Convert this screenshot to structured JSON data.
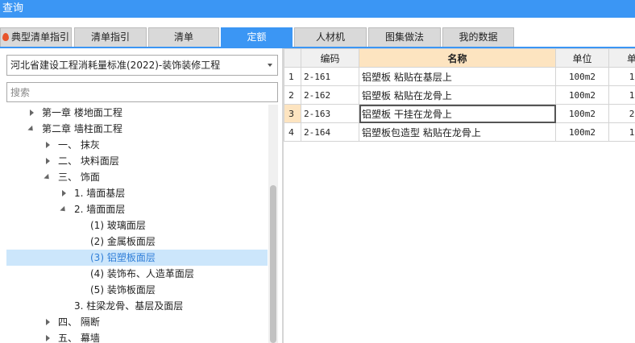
{
  "window": {
    "title": "查询"
  },
  "tabs": [
    {
      "label": "典型清单指引",
      "active": false,
      "has_icon": true
    },
    {
      "label": "清单指引",
      "active": false
    },
    {
      "label": "清单",
      "active": false
    },
    {
      "label": "定额",
      "active": true
    },
    {
      "label": "人材机",
      "active": false
    },
    {
      "label": "图集做法",
      "active": false
    },
    {
      "label": "我的数据",
      "active": false
    }
  ],
  "left_panel": {
    "standard_select": "河北省建设工程消耗量标准(2022)-装饰装修工程",
    "search_placeholder": "搜索",
    "tree": [
      {
        "label": "第一章  楼地面工程",
        "toggle": "collapsed",
        "selected": false
      },
      {
        "label": "第二章  墙柱面工程",
        "toggle": "expanded",
        "selected": false
      },
      {
        "label": "一、  抹灰",
        "toggle": "collapsed",
        "selected": false
      },
      {
        "label": "二、  块料面层",
        "toggle": "collapsed",
        "selected": false
      },
      {
        "label": "三、  饰面",
        "toggle": "expanded",
        "selected": false
      },
      {
        "label": "1. 墙面基层",
        "toggle": "collapsed",
        "selected": false
      },
      {
        "label": "2. 墙面面层",
        "toggle": "expanded",
        "selected": false
      },
      {
        "label": "(1) 玻璃面层",
        "toggle": "none",
        "selected": false
      },
      {
        "label": "(2) 金属板面层",
        "toggle": "none",
        "selected": false
      },
      {
        "label": "(3) 铝塑板面层",
        "toggle": "none",
        "selected": true
      },
      {
        "label": "(4) 装饰布、人造革面层",
        "toggle": "none",
        "selected": false
      },
      {
        "label": "(5) 装饰板面层",
        "toggle": "none",
        "selected": false
      },
      {
        "label": "3. 柱梁龙骨、基层及面层",
        "toggle": "none",
        "selected": false
      },
      {
        "label": "四、  隔断",
        "toggle": "collapsed",
        "selected": false
      },
      {
        "label": "五、  幕墙",
        "toggle": "collapsed",
        "selected": false
      }
    ]
  },
  "grid": {
    "columns": [
      "",
      "编码",
      "名称",
      "单位",
      "单"
    ],
    "highlight_column": 2,
    "current_row": 2,
    "rows": [
      {
        "n": "1",
        "code": "2-161",
        "name": "铝塑板 粘贴在基层上",
        "unit": "100m2",
        "extra": "1"
      },
      {
        "n": "2",
        "code": "2-162",
        "name": "铝塑板 粘贴在龙骨上",
        "unit": "100m2",
        "extra": "1"
      },
      {
        "n": "3",
        "code": "2-163",
        "name": "铝塑板 干挂在龙骨上",
        "unit": "100m2",
        "extra": "2"
      },
      {
        "n": "4",
        "code": "2-164",
        "name": "铝塑板包造型 粘贴在龙骨上",
        "unit": "100m2",
        "extra": "1"
      }
    ]
  },
  "colors": {
    "accent": "#3b96f4",
    "selection": "#cce6fb",
    "header_highlight": "#fde4c0"
  }
}
